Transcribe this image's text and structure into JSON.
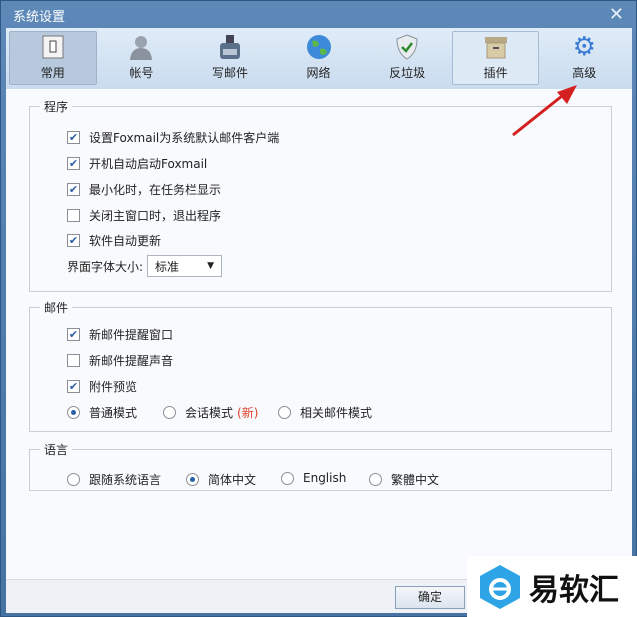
{
  "window": {
    "title": "系统设置",
    "close_icon": "close-icon"
  },
  "toolbar": {
    "items": [
      {
        "label": "常用",
        "icon": "switch-icon",
        "state": "active"
      },
      {
        "label": "帐号",
        "icon": "user-icon"
      },
      {
        "label": "写邮件",
        "icon": "inkwell-icon"
      },
      {
        "label": "网络",
        "icon": "globe-icon"
      },
      {
        "label": "反垃圾",
        "icon": "shield-icon"
      },
      {
        "label": "插件",
        "icon": "box-icon",
        "state": "hover"
      },
      {
        "label": "高级",
        "icon": "gear-icon"
      }
    ]
  },
  "program": {
    "title": "程序",
    "options": [
      {
        "label": "设置Foxmail为系统默认邮件客户端",
        "checked": true
      },
      {
        "label": "开机自动启动Foxmail",
        "checked": true
      },
      {
        "label": "最小化时，在任务栏显示",
        "checked": true
      },
      {
        "label": "关闭主窗口时，退出程序",
        "checked": false
      },
      {
        "label": "软件自动更新",
        "checked": true
      }
    ],
    "font_size_label": "界面字体大小:",
    "font_size_value": "标准"
  },
  "mail": {
    "title": "邮件",
    "options": [
      {
        "label": "新邮件提醒窗口",
        "checked": true
      },
      {
        "label": "新邮件提醒声音",
        "checked": false
      },
      {
        "label": "附件预览",
        "checked": true
      }
    ],
    "modes": [
      {
        "label": "普通模式",
        "selected": true
      },
      {
        "label": "会话模式",
        "badge": "(新)",
        "selected": false
      },
      {
        "label": "相关邮件模式",
        "selected": false
      }
    ],
    "badge_color": "#e0402a"
  },
  "language": {
    "title": "语言",
    "options": [
      {
        "label": "跟随系统语言",
        "selected": false
      },
      {
        "label": "简体中文",
        "selected": true
      },
      {
        "label": "English",
        "selected": false
      },
      {
        "label": "繁體中文",
        "selected": false
      }
    ]
  },
  "footer": {
    "ok_label": "确定"
  },
  "watermark": {
    "text": "易软汇"
  }
}
